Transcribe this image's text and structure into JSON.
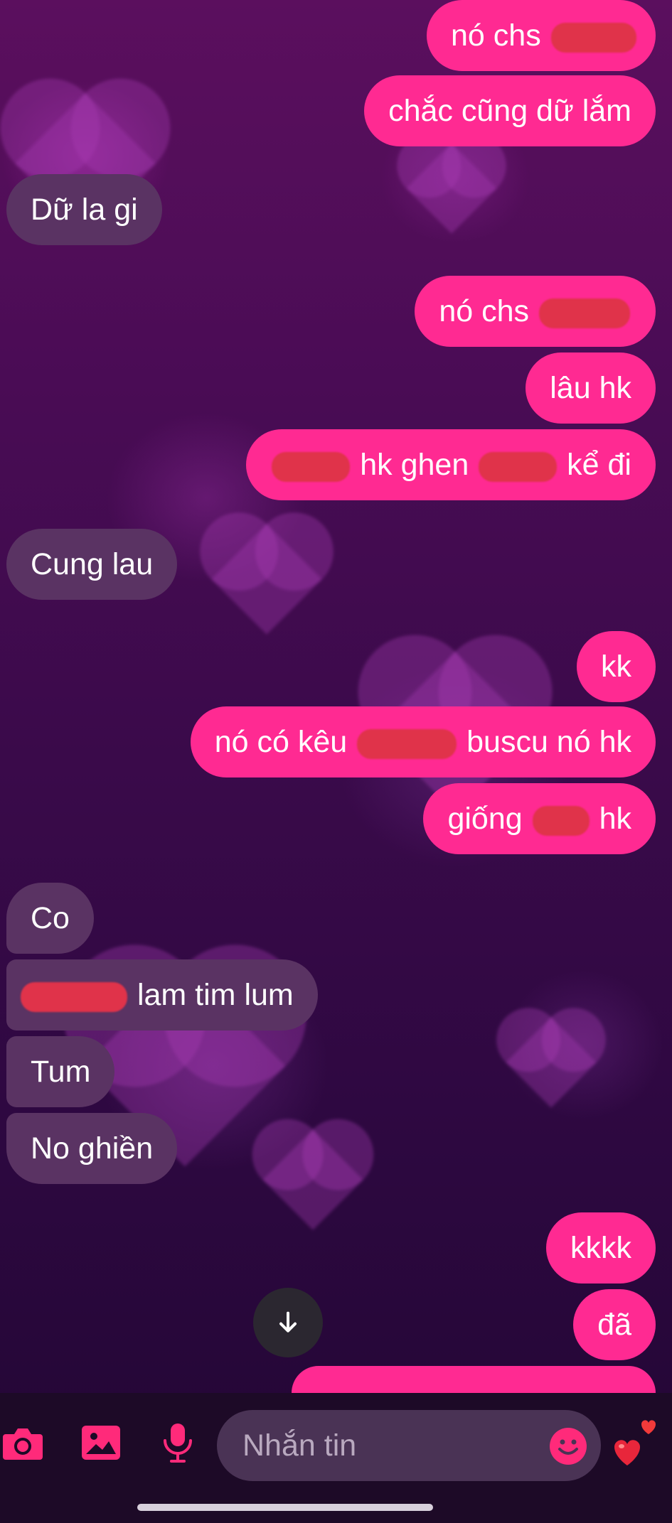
{
  "messages": {
    "m1": {
      "before": "nó chs",
      "after": ""
    },
    "m2": {
      "text": "chắc cũng dữ lắm"
    },
    "m3": {
      "text": "Dữ la gi"
    },
    "m4": {
      "before": "nó chs",
      "after": ""
    },
    "m5": {
      "text": "lâu hk"
    },
    "m6": {
      "before": "",
      "middle": "hk ghen",
      "after": "kể đi"
    },
    "m7": {
      "text": "Cung lau"
    },
    "m8": {
      "text": "kk"
    },
    "m9": {
      "before": "nó có kêu",
      "after": "buscu nó hk"
    },
    "m10": {
      "before": "giống",
      "after": "hk"
    },
    "m11": {
      "text": "Co"
    },
    "m12": {
      "before": "",
      "after": "lam tim lum"
    },
    "m13": {
      "text": "Tum"
    },
    "m14": {
      "text": "No ghiền"
    },
    "m15": {
      "text": "kkkk"
    },
    "m16": {
      "text": "đã"
    }
  },
  "composer": {
    "placeholder": "Nhắn tin",
    "icons": [
      "camera-icon",
      "image-icon",
      "microphone-icon",
      "emoji-icon",
      "heart-emoji-icon"
    ]
  },
  "colors": {
    "sent_bubble": "#ff2a92",
    "received_bubble": "#5a3363",
    "accent": "#ff2a7a"
  }
}
